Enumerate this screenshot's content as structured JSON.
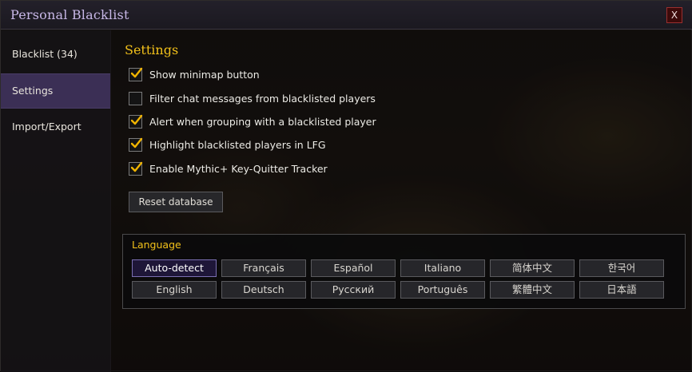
{
  "window": {
    "title": "Personal Blacklist",
    "close_label": "X"
  },
  "sidebar": {
    "items": [
      {
        "label": "Blacklist (34)",
        "active": false
      },
      {
        "label": "Settings",
        "active": true
      },
      {
        "label": "Import/Export",
        "active": false
      }
    ]
  },
  "settings": {
    "title": "Settings",
    "options": [
      {
        "label": "Show minimap button",
        "checked": true
      },
      {
        "label": "Filter chat messages from blacklisted players",
        "checked": false
      },
      {
        "label": "Alert when grouping with a blacklisted player",
        "checked": true
      },
      {
        "label": "Highlight blacklisted players in LFG",
        "checked": true
      },
      {
        "label": "Enable Mythic+ Key-Quitter Tracker",
        "checked": true
      }
    ],
    "reset_label": "Reset database"
  },
  "language": {
    "title": "Language",
    "selected": "Auto-detect",
    "options": [
      [
        "Auto-detect",
        "Français",
        "Español",
        "Italiano",
        "简体中文",
        "한국어"
      ],
      [
        "English",
        "Deutsch",
        "Русский",
        "Português",
        "繁體中文",
        "日本語"
      ]
    ]
  },
  "colors": {
    "accent_gold": "#f2c11a",
    "title_purple": "#c7b7e6",
    "active_nav": "#3b2f55",
    "checkmark": "#f0b400"
  }
}
